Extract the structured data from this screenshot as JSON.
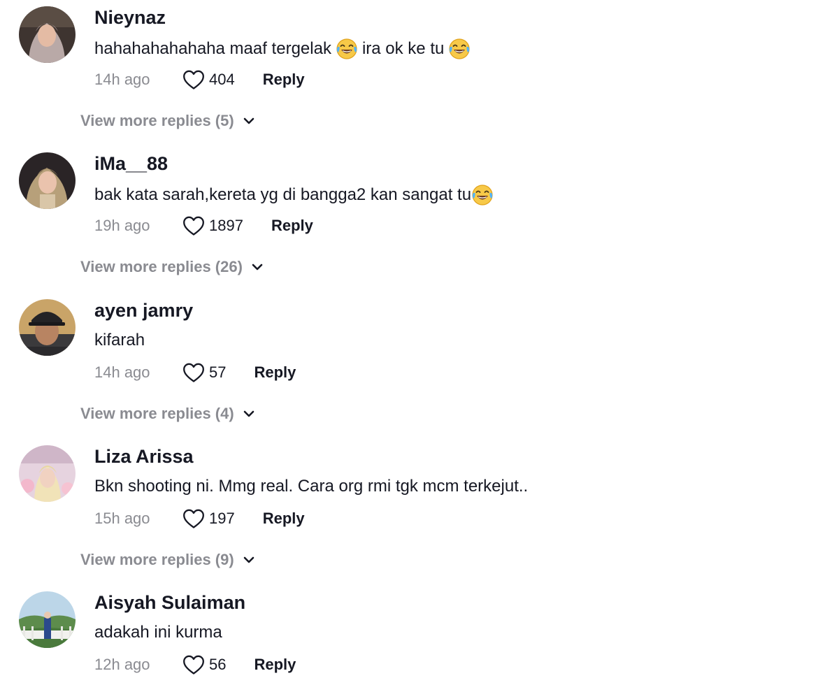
{
  "comments": [
    {
      "username": "Nieynaz",
      "text_parts": [
        "hahahahahahaha maaf tergelak",
        "ira ok ke tu"
      ],
      "time": "14h ago",
      "likes": "404",
      "reply_label": "Reply",
      "more_replies": "View more replies (5)"
    },
    {
      "username": "iMa__88",
      "text_parts": [
        "bak kata sarah,kereta yg di bangga2 kan sangat tu"
      ],
      "time": "19h ago",
      "likes": "1897",
      "reply_label": "Reply",
      "more_replies": "View more replies (26)"
    },
    {
      "username": "ayen jamry",
      "text_parts": [
        "kifarah"
      ],
      "time": "14h ago",
      "likes": "57",
      "reply_label": "Reply",
      "more_replies": "View more replies (4)"
    },
    {
      "username": "Liza Arissa",
      "text_parts": [
        "Bkn shooting ni. Mmg real. Cara org rmi tgk mcm terkejut.."
      ],
      "time": "15h ago",
      "likes": "197",
      "reply_label": "Reply",
      "more_replies": "View more replies (9)"
    },
    {
      "username": "Aisyah Sulaiman",
      "text_parts": [
        "adakah ini kurma"
      ],
      "time": "12h ago",
      "likes": "56",
      "reply_label": "Reply"
    }
  ],
  "icons": {
    "like": "heart-outline-icon",
    "expand": "chevron-down-icon",
    "emoji": "face-with-tears-of-joy-emoji"
  },
  "colors": {
    "primary_text": "#161823",
    "secondary_text": "#8a8b91",
    "background": "#ffffff"
  }
}
